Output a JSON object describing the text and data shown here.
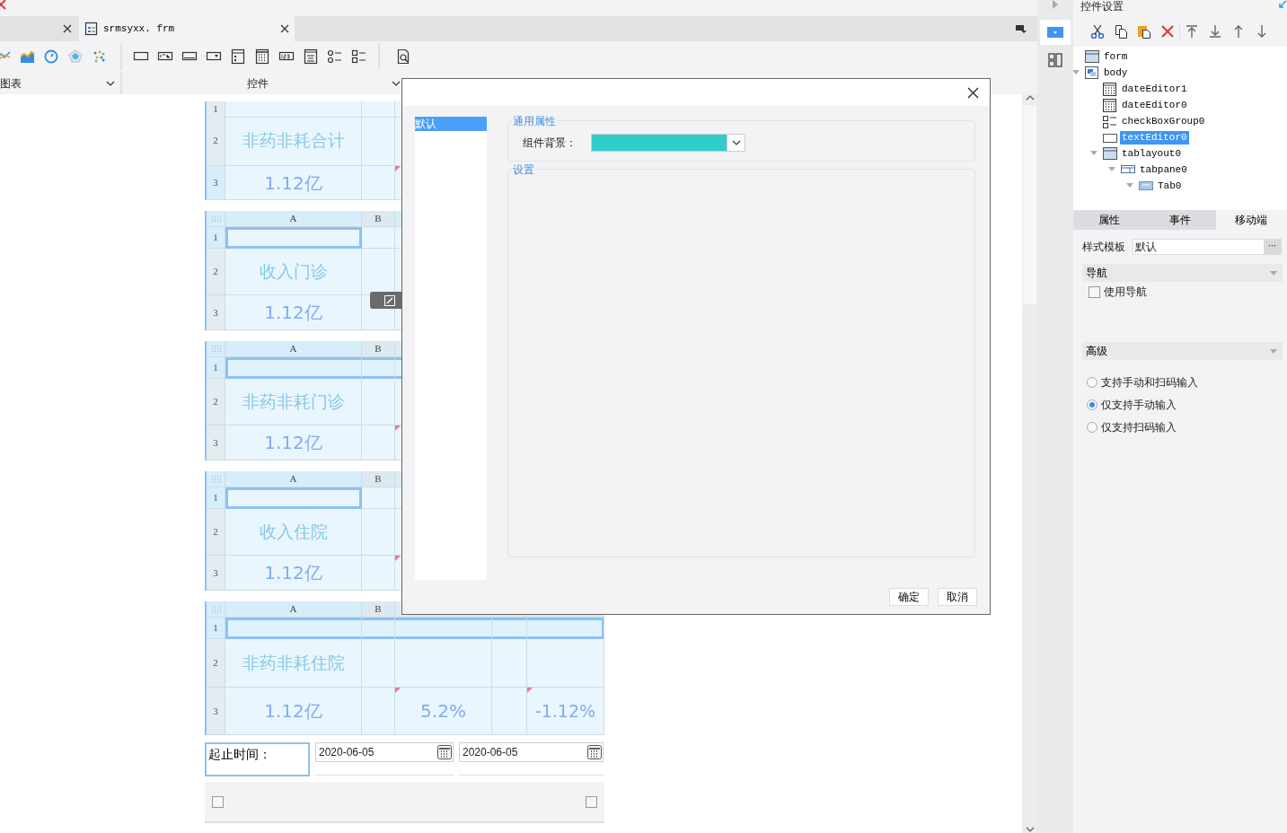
{
  "editor_tabs": [
    {
      "selected": false
    },
    {
      "label": "srmsyxx. frm",
      "selected": true
    }
  ],
  "toolbar_groups": [
    {
      "label": "图表",
      "kind": "charts"
    },
    {
      "label": "控件",
      "kind": "controls"
    }
  ],
  "form_blocks": [
    {
      "row_numbers": [
        "1",
        "2",
        "3"
      ],
      "title": "非药非耗合计",
      "values": [
        "1.12亿"
      ],
      "cell_selected": false,
      "row_selected": false
    },
    {
      "columns": [
        "A",
        "B"
      ],
      "row_numbers": [
        "1",
        "2",
        "3"
      ],
      "title": "收入门诊",
      "values": [
        "1.12亿"
      ],
      "cell_selected": true,
      "row_selected": false
    },
    {
      "columns": [
        "A",
        "B"
      ],
      "row_numbers": [
        "1",
        "2",
        "3"
      ],
      "title": "非药非耗门诊",
      "values": [
        "1.12亿"
      ],
      "cell_selected": false,
      "row_selected": true
    },
    {
      "columns": [
        "A",
        "B"
      ],
      "row_numbers": [
        "1",
        "2",
        "3"
      ],
      "title": "收入住院",
      "values": [
        "1.12亿"
      ],
      "cell_selected": true,
      "row_selected": false
    },
    {
      "columns": [
        "A",
        "B"
      ],
      "row_numbers": [
        "1",
        "2",
        "3"
      ],
      "title": "非药非耗住院",
      "values": [
        "1.12亿",
        "5.2%",
        "-1.12%"
      ],
      "cell_selected": false,
      "row_selected": true
    }
  ],
  "date_range": {
    "label": "起止时间：",
    "start": "2020-06-05",
    "end": "2020-06-05"
  },
  "bottom_checkboxes": [
    {
      "checked": false
    },
    {
      "checked": false
    }
  ],
  "dialog": {
    "styles": [
      {
        "label": "默认",
        "selected": true
      }
    ],
    "sections": [
      {
        "title": "通用属性",
        "fields": [
          {
            "label": "组件背景：",
            "color": "#33cccc"
          }
        ]
      },
      {
        "title": "设置"
      }
    ],
    "buttons": [
      "确定",
      "取消"
    ]
  },
  "side_panel": {
    "title": "控件设置",
    "tree": [
      {
        "label": "form",
        "kind": "form",
        "selected": false
      },
      {
        "label": "body",
        "kind": "body",
        "selected": false,
        "expanded": true,
        "children": [
          {
            "label": "dateEditor1",
            "kind": "date",
            "selected": false
          },
          {
            "label": "dateEditor0",
            "kind": "date",
            "selected": false
          },
          {
            "label": "checkBoxGroup0",
            "kind": "checkbox",
            "selected": false
          },
          {
            "label": "textEditor0",
            "kind": "text",
            "selected": true
          },
          {
            "label": "tablayout0",
            "kind": "layout",
            "selected": false,
            "expanded": true,
            "children": [
              {
                "label": "tabpane0",
                "kind": "pane",
                "selected": false,
                "expanded": true,
                "children": [
                  {
                    "label": "Tab0",
                    "kind": "tab",
                    "selected": false,
                    "expanded": true
                  }
                ]
              }
            ]
          }
        ]
      }
    ],
    "tabs": [
      {
        "label": "属性",
        "selected": false
      },
      {
        "label": "事件",
        "selected": false
      },
      {
        "label": "移动端",
        "selected": true
      }
    ],
    "style_template": {
      "label": "样式模板",
      "value": "默认",
      "button": "···"
    },
    "sections": [
      {
        "title": "导航",
        "options": [
          {
            "kind": "checkbox",
            "label": "使用导航",
            "checked": false
          }
        ]
      },
      {
        "title": "高级",
        "options": [
          {
            "kind": "radio",
            "label": "支持手动和扫码输入",
            "selected": false
          },
          {
            "kind": "radio",
            "label": "仅支持手动输入",
            "selected": true
          },
          {
            "kind": "radio",
            "label": "仅支持扫码输入",
            "selected": false
          }
        ]
      }
    ]
  }
}
